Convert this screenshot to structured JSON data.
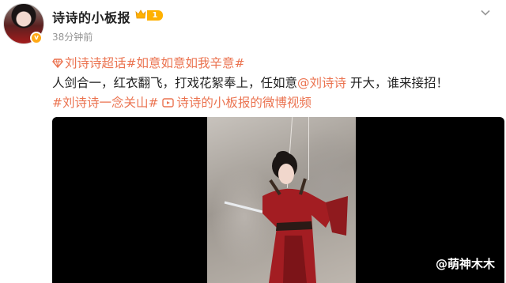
{
  "post": {
    "author_name": "诗诗的小板报",
    "level_badge": "1",
    "verified_mark": "v",
    "time": "38分钟前",
    "more_icon": "chevron-down-icon"
  },
  "content": {
    "topic_line": {
      "super_topic": "刘诗诗超话",
      "topic2": "#如意如意如我辛意#"
    },
    "body_line": {
      "part1": "人剑合一，红衣翻飞，打戏花絮奉上，任如意",
      "mention": "@刘诗诗",
      "part2": " 开大，谁来接招！"
    },
    "tag_line": {
      "topic": "#刘诗诗一念关山#",
      "video_link": "诗诗的小板报的微博视频"
    }
  },
  "media": {
    "watermark": "@萌神木木"
  },
  "colors": {
    "accent": "#eb7350",
    "badge": "#ffb100",
    "time": "#939393"
  }
}
